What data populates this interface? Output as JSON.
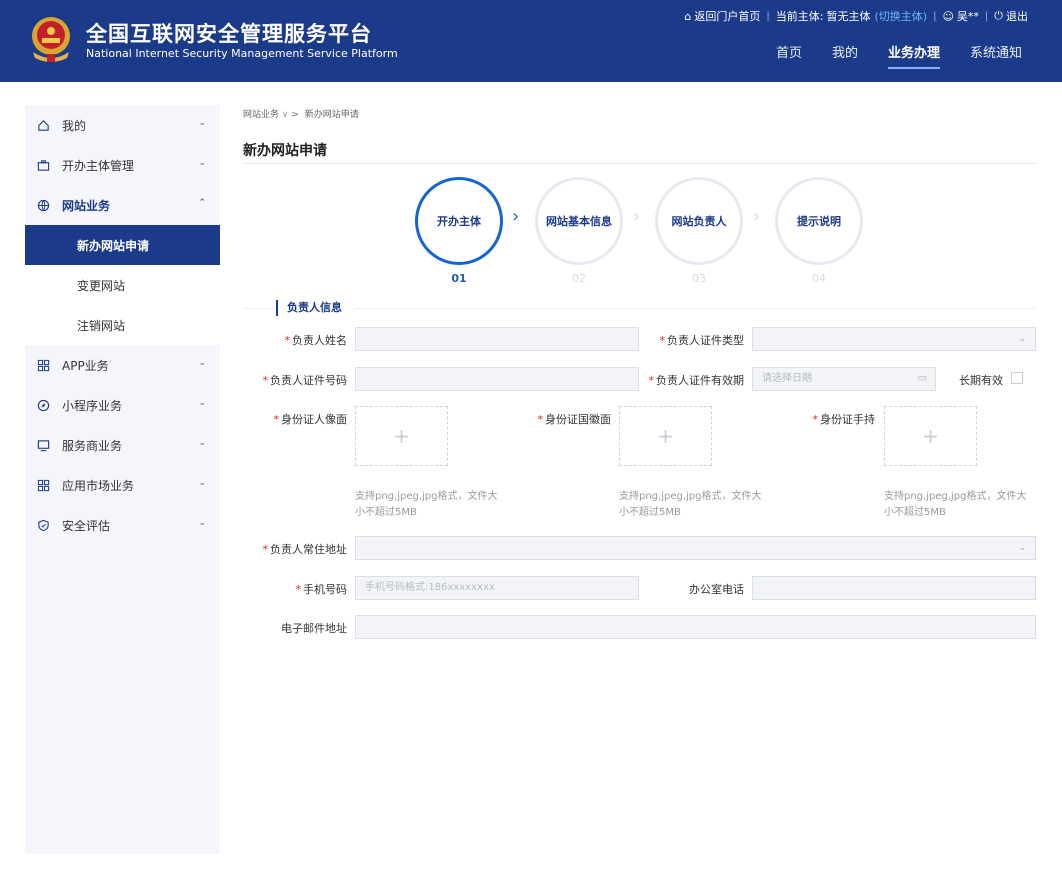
{
  "header": {
    "title": "全国互联网安全管理服务平台",
    "subtitle": "National Internet Security Management Service Platform",
    "top_links": {
      "home_portal": "返回门户首页",
      "current_subject_label": "当前主体:",
      "current_subject_value": "暂无主体",
      "switch_subject": "(切换主体)",
      "user": "吴**",
      "logout": "退出"
    },
    "nav": [
      "首页",
      "我的",
      "业务办理",
      "系统通知"
    ],
    "active_nav": "业务办理"
  },
  "sidebar": {
    "items": [
      {
        "label": "我的",
        "icon": "home-icon"
      },
      {
        "label": "开办主体管理",
        "icon": "briefcase-icon"
      },
      {
        "label": "网站业务",
        "icon": "globe-icon"
      },
      {
        "label": "APP业务",
        "icon": "grid-icon"
      },
      {
        "label": "小程序业务",
        "icon": "compass-icon"
      },
      {
        "label": "服务商业务",
        "icon": "monitor-icon"
      },
      {
        "label": "应用市场业务",
        "icon": "grid-icon"
      },
      {
        "label": "安全评估",
        "icon": "shield-icon"
      }
    ],
    "sub_items": [
      "新办网站申请",
      "变更网站",
      "注销网站"
    ],
    "active_sub": "新办网站申请"
  },
  "breadcrumb": {
    "parent": "网站业务",
    "sep": ">",
    "current": "新办网站申请"
  },
  "page_title": "新办网站申请",
  "steps": [
    {
      "label": "开办主体",
      "num": "01"
    },
    {
      "label": "网站基本信息",
      "num": "02"
    },
    {
      "label": "网站负责人",
      "num": "03"
    },
    {
      "label": "提示说明",
      "num": "04"
    }
  ],
  "active_step": 1,
  "section_title": "负责人信息",
  "form": {
    "name_label": "负责人姓名",
    "id_type_label": "负责人证件类型",
    "id_number_label": "负责人证件号码",
    "id_validity_label": "负责人证件有效期",
    "date_placeholder": "请选择日期",
    "long_term_label": "长期有效",
    "front_label": "身份证人像面",
    "back_label": "身份证国徽面",
    "hand_label": "身份证手持",
    "upload_plus": "+",
    "upload_hint": "支持png,jpeg,jpg格式，文件大小不超过5MB",
    "address_label": "负责人常住地址",
    "phone_label": "手机号码",
    "phone_placeholder": "手机号码格式:186xxxxxxxx",
    "office_phone_label": "办公室电话",
    "email_label": "电子邮件地址"
  },
  "colors": {
    "primary": "#1c3a8a",
    "accent": "#1464d4",
    "required": "#e02020"
  }
}
